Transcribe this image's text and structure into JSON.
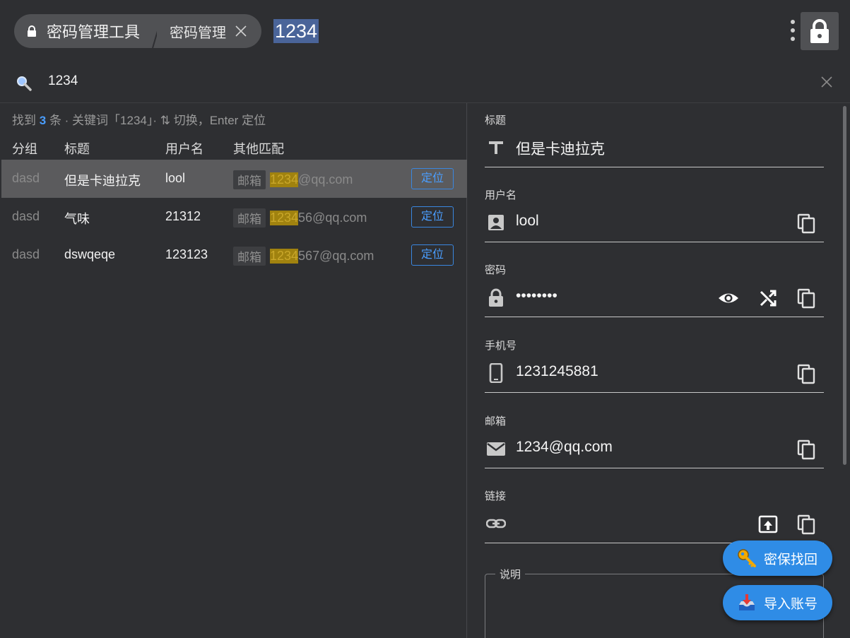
{
  "header": {
    "app_title": "密码管理工具",
    "tab_label": "密码管理",
    "search_selection": "1234"
  },
  "search": {
    "query": "1234"
  },
  "results": {
    "summary_prefix": "找到",
    "count": "3",
    "summary_suffix": "条 · 关键词「1234」· ⇅ 切换，Enter 定位",
    "columns": [
      "分组",
      "标题",
      "用户名",
      "其他匹配"
    ],
    "rows": [
      {
        "group": "dasd",
        "title": "但是卡迪拉克",
        "username": "lool",
        "match_tag": "邮箱",
        "match_hl": "1234",
        "match_rest": "@qq.com",
        "action": "定位"
      },
      {
        "group": "dasd",
        "title": "气味",
        "username": "21312",
        "match_tag": "邮箱",
        "match_hl": "1234",
        "match_rest": "56@qq.com",
        "action": "定位"
      },
      {
        "group": "dasd",
        "title": "dswqeqe",
        "username": "123123",
        "match_tag": "邮箱",
        "match_hl": "1234",
        "match_rest": "567@qq.com",
        "action": "定位"
      }
    ],
    "selected_index": 0
  },
  "detail": {
    "title": {
      "label": "标题",
      "value": "但是卡迪拉克"
    },
    "username": {
      "label": "用户名",
      "value": "lool"
    },
    "password": {
      "label": "密码",
      "value": "••••••••"
    },
    "phone": {
      "label": "手机号",
      "value": "1231245881"
    },
    "email": {
      "label": "邮箱",
      "value": "1234@qq.com"
    },
    "link": {
      "label": "链接",
      "value": ""
    },
    "note": {
      "label": "说明"
    }
  },
  "fabs": {
    "recover": "密保找回",
    "import": "导入账号"
  },
  "colors": {
    "accent": "#2f8ce6",
    "highlight": "#a0820f",
    "selection": "#4a6499"
  }
}
